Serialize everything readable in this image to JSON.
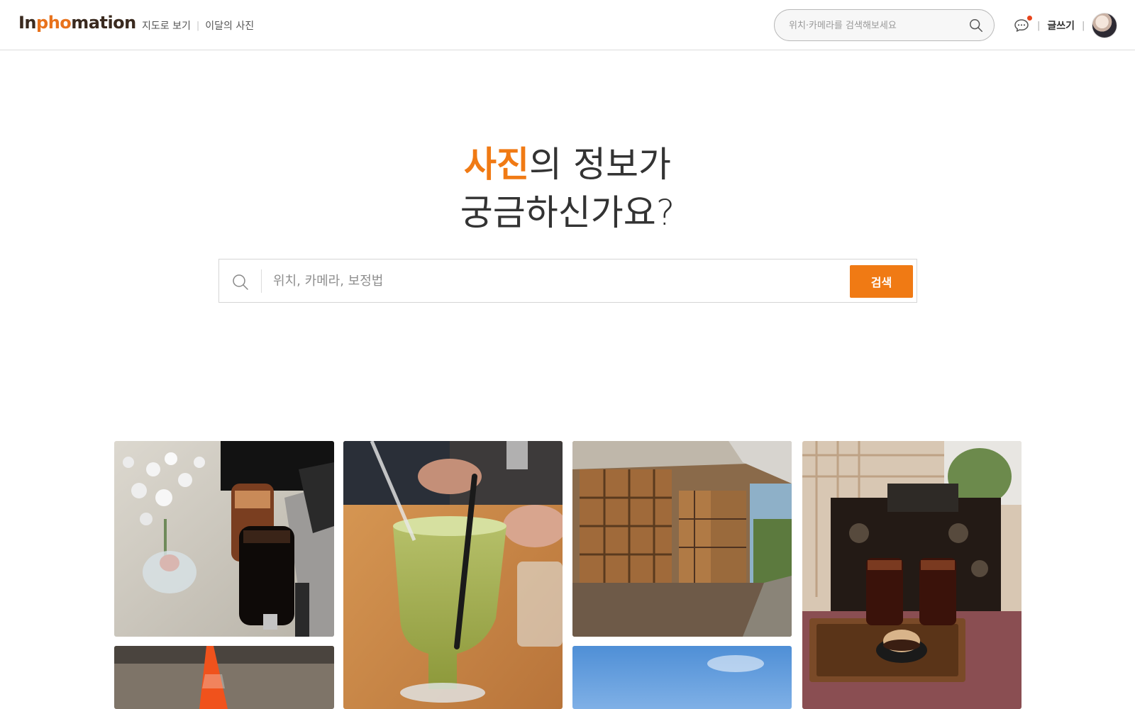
{
  "brand": {
    "logo_pre": "In",
    "logo_accent": "pho",
    "logo_post": "mation",
    "accent_color": "#f07a14"
  },
  "nav": {
    "map_view": "지도로 보기",
    "photo_of_month": "이달의 사진"
  },
  "header": {
    "search_placeholder": "위치·카메라를 검색해보세요",
    "write_label": "글쓰기",
    "chat_icon": "chat-bubble-icon",
    "search_icon": "search-icon"
  },
  "hero": {
    "line1_accent": "사진",
    "line1_rest": "의 정보가",
    "line2": "궁금하신가요?"
  },
  "main_search": {
    "placeholder": "위치, 카메라, 보정법",
    "button_label": "검색"
  },
  "photos": [
    {
      "subject": "cafe-table-iced-drinks-flowers"
    },
    {
      "subject": "green-mojito-glass-wood-table"
    },
    {
      "subject": "wooden-hanok-house-windows"
    },
    {
      "subject": "iced-americano-tray-hanok"
    },
    {
      "subject": "traffic-cone-interior"
    },
    {
      "subject": "blue-sky"
    }
  ]
}
